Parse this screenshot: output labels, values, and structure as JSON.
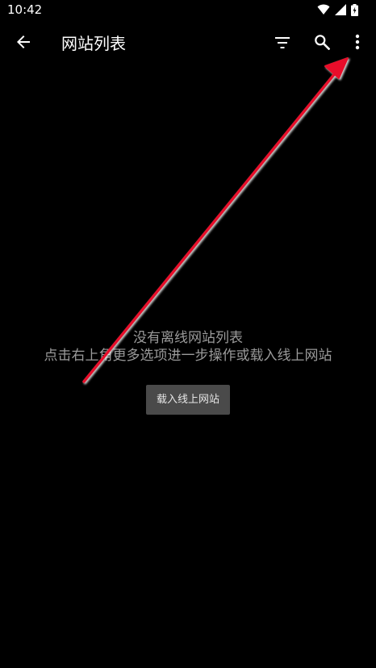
{
  "status_bar": {
    "time": "10:42",
    "icons": [
      "wifi-icon",
      "cellular-signal-icon",
      "battery-charging-icon"
    ]
  },
  "app_bar": {
    "title": "网站列表",
    "back_icon": "arrow-back-icon",
    "actions": [
      "filter-icon",
      "search-icon",
      "more-vert-icon"
    ]
  },
  "empty_state": {
    "title": "没有离线网站列表",
    "hint": "点击右上角更多选项进一步操作或载入线上网站",
    "button_label": "载入线上网站"
  },
  "annotation": {
    "arrow_color": "#e8102a",
    "points_to": "more-vert-icon"
  },
  "colors": {
    "background": "#000000",
    "text_primary": "#ffffff",
    "text_secondary": "#9a9a9a",
    "button_bg": "#4a4a4a"
  }
}
